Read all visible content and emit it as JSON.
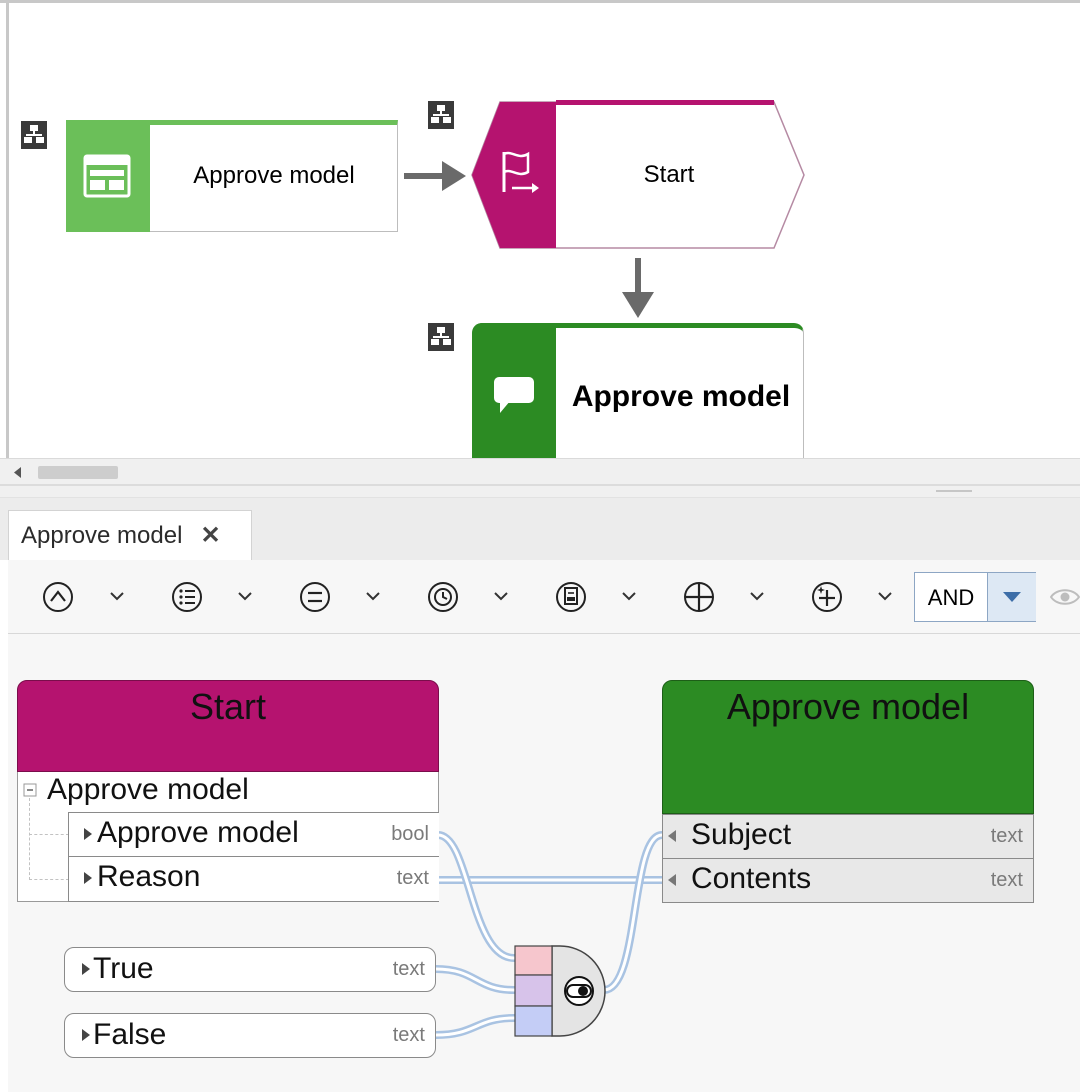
{
  "model": {
    "nodes": [
      {
        "label": "Approve model",
        "kind": "function",
        "icon": "screen-icon",
        "color": "#6bbf59"
      },
      {
        "label": "Start",
        "kind": "event",
        "icon": "flag-start-icon",
        "color": "#b5136f"
      },
      {
        "label": "Approve model",
        "kind": "user-task",
        "icon": "speech-bubble-icon",
        "color": "#2c8b23"
      }
    ]
  },
  "editor_tab": {
    "label": "Approve model",
    "close": "✕"
  },
  "toolbar": {
    "buttons": [
      "caret-up-icon",
      "list-icon",
      "equals-icon",
      "clock-icon",
      "document-icon",
      "plus-icon",
      "plus-sparkle-icon"
    ],
    "operator": "AND",
    "eye": "eye-icon"
  },
  "mapping": {
    "source": {
      "title": "Start",
      "color": "#b5136f",
      "group": "Approve model",
      "rows": [
        {
          "label": "Approve model",
          "type": "bool"
        },
        {
          "label": "Reason",
          "type": "text"
        }
      ]
    },
    "constants": [
      {
        "label": "True",
        "type": "text"
      },
      {
        "label": "False",
        "type": "text"
      }
    ],
    "target": {
      "title": "Approve model",
      "color": "#2c8b23",
      "rows": [
        {
          "label": "Subject",
          "type": "text"
        },
        {
          "label": "Contents",
          "type": "text"
        }
      ]
    },
    "operator_icon": "toggle-switch-icon"
  }
}
